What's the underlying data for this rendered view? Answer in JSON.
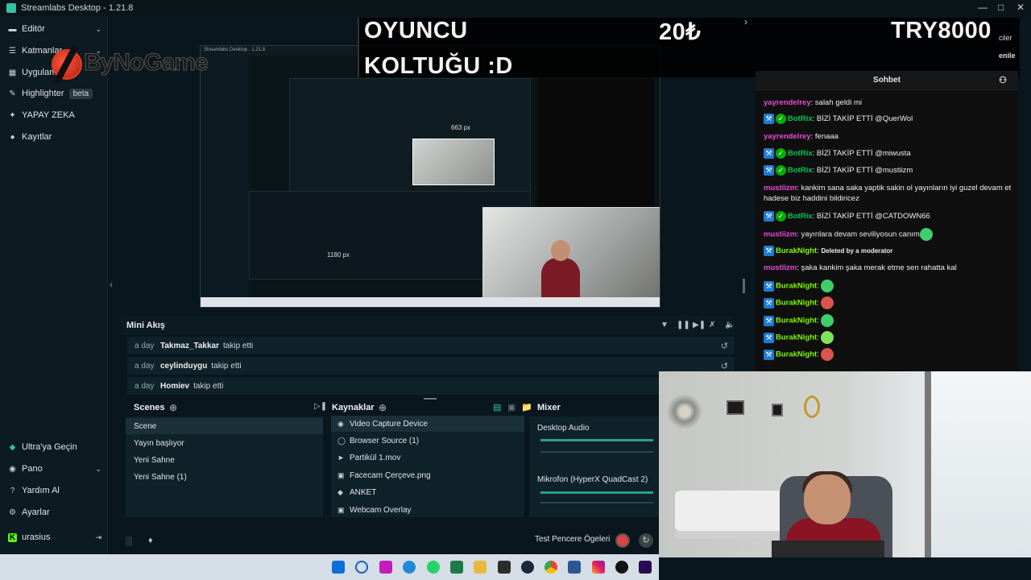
{
  "window": {
    "title": "Streamlabs Desktop - 1.21.8"
  },
  "sidebar": {
    "items": [
      {
        "label": "Editör",
        "icon": "editor-icon",
        "chevron": true
      },
      {
        "label": "Katmanlar",
        "icon": "layers-icon",
        "chevron": true
      },
      {
        "label": "Uygulamalar",
        "icon": "apps-icon"
      },
      {
        "label": "Highlighter",
        "icon": "highlighter-icon",
        "badge": "beta"
      },
      {
        "label": "YAPAY ZEKA",
        "icon": "ai-icon"
      },
      {
        "label": "Kayıtlar",
        "icon": "recordings-icon"
      }
    ],
    "bottom_items": [
      {
        "label": "Ultra'ya Geçin",
        "icon": "ultra-icon"
      },
      {
        "label": "Pano",
        "icon": "dashboard-icon",
        "chevron": true
      },
      {
        "label": "Yardım Al",
        "icon": "help-icon"
      },
      {
        "label": "Ayarlar",
        "icon": "settings-icon"
      }
    ],
    "user": {
      "name": "urasius",
      "icon": "kick-icon"
    }
  },
  "watermark": {
    "text": "ByNoGame"
  },
  "overlay": {
    "line1": "OYUNCU",
    "line2": "KOLTUĞU :D",
    "amount": "20₺",
    "goal": "TRY8000",
    "partial_right1": "ciler",
    "partial_right2": "enile"
  },
  "miniflow": {
    "title": "Mini Akış",
    "events": [
      {
        "time": "a day",
        "name": "Takmaz_Takkar",
        "action": "takip etti"
      },
      {
        "time": "a day",
        "name": "ceylinduygu",
        "action": "takip etti"
      },
      {
        "time": "a day",
        "name": "Homiev",
        "action": "takip etti"
      }
    ]
  },
  "scenes": {
    "title": "Scenes",
    "items": [
      {
        "label": "Scene",
        "selected": true
      },
      {
        "label": "Yayın başlıyor"
      },
      {
        "label": "Yeni Sahne"
      },
      {
        "label": "Yeni Sahne (1)"
      }
    ]
  },
  "sources": {
    "title": "Kaynaklar",
    "items": [
      {
        "label": "Video Capture Device",
        "icon": "camera-icon",
        "selected": true
      },
      {
        "label": "Browser Source (1)",
        "icon": "globe-icon"
      },
      {
        "label": "Partikül 1.mov",
        "icon": "video-file-icon"
      },
      {
        "label": "Facecam Çerçeve.png",
        "icon": "image-icon"
      },
      {
        "label": "ANKET",
        "icon": "widget-icon"
      },
      {
        "label": "Webcam Overlay",
        "icon": "image-icon"
      }
    ]
  },
  "mixer": {
    "title": "Mixer",
    "channels": [
      {
        "name": "Desktop Audio"
      },
      {
        "name": "Mikrofon (HyperX QuadCast 2)"
      }
    ]
  },
  "footer": {
    "test_label": "Test Pencere Ögeleri"
  },
  "chat": {
    "title": "Sohbet",
    "messages": [
      {
        "user": "yayrendelrey",
        "color": "#e74bd8",
        "text": "salah geldi mi"
      },
      {
        "user": "BotRix",
        "color": "#00c853",
        "badges": true,
        "text": "BİZİ TAKİP ETTİ @QuerWol"
      },
      {
        "user": "yayrendelrey",
        "color": "#e74bd8",
        "text": "fenaaa"
      },
      {
        "user": "BotRix",
        "color": "#00c853",
        "badges": true,
        "text": "BİZİ TAKİP ETTİ @miwusta"
      },
      {
        "user": "BotRix",
        "color": "#00c853",
        "badges": true,
        "text": "BİZİ TAKİP ETTİ @mustiizm"
      },
      {
        "user": "mustiizm",
        "color": "#e74bd8",
        "text": "kankim sana saka yaptik sakin ol yayınların iyi guzel devam et hadese biz haddini bildiricez"
      },
      {
        "user": "BotRix",
        "color": "#00c853",
        "badges": true,
        "text": "BİZİ TAKİP ETTİ @CATDOWN66"
      },
      {
        "user": "mustiizm",
        "color": "#e74bd8",
        "text": "yayınlara devam seviliyosun canım"
      },
      {
        "user": "BurakNight",
        "color": "#7cfc00",
        "badges_mod": true,
        "text": "Deleted by a moderator"
      },
      {
        "user": "mustiizm",
        "color": "#e74bd8",
        "text": "şaka kankim şaka merak etme sen rahatta kal"
      },
      {
        "user": "BurakNight",
        "color": "#7cfc00",
        "badges_mod": true,
        "text": ""
      },
      {
        "user": "BurakNight",
        "color": "#7cfc00",
        "badges_mod": true,
        "text": ""
      },
      {
        "user": "BurakNight",
        "color": "#7cfc00",
        "badges_mod": true,
        "text": ""
      },
      {
        "user": "BurakNight",
        "color": "#7cfc00",
        "badges_mod": true,
        "text": ""
      },
      {
        "user": "BurakNight",
        "color": "#7cfc00",
        "badges_mod": true,
        "text": ""
      }
    ],
    "emote_colors": [
      "#3ecf6a",
      "#3ecf6a",
      "#d9534f",
      "#3ecf6a",
      "#7ee35b",
      "#d9534f"
    ]
  },
  "preview_labels": {
    "px1": "663 px",
    "px2": "1180 px"
  },
  "colors": {
    "accent": "#31c3a2",
    "sidebar_bg": "#0c1a21",
    "panel_bg": "#0f2129",
    "selected": "#1b3038"
  }
}
